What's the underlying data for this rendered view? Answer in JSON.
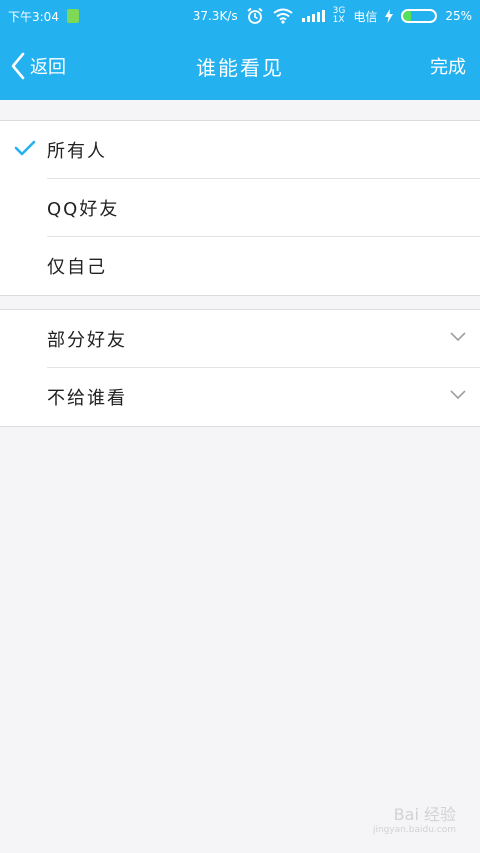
{
  "status": {
    "time": "下午3:04",
    "speed": "37.3K/s",
    "network": "3G",
    "network_sub": "1X",
    "carrier": "电信",
    "battery": "25%",
    "battery_level": 0.25,
    "accent": "#23b1f0"
  },
  "nav": {
    "back_label": "返回",
    "title": "谁能看见",
    "done_label": "完成"
  },
  "options": [
    {
      "label": "所有人",
      "selected": true
    },
    {
      "label": "QQ好友",
      "selected": false
    },
    {
      "label": "仅自己",
      "selected": false
    }
  ],
  "partial": [
    {
      "label": "部分好友"
    },
    {
      "label": "不给谁看"
    }
  ],
  "watermark": {
    "brand": "Bai 经验",
    "url": "jingyan.baidu.com"
  }
}
